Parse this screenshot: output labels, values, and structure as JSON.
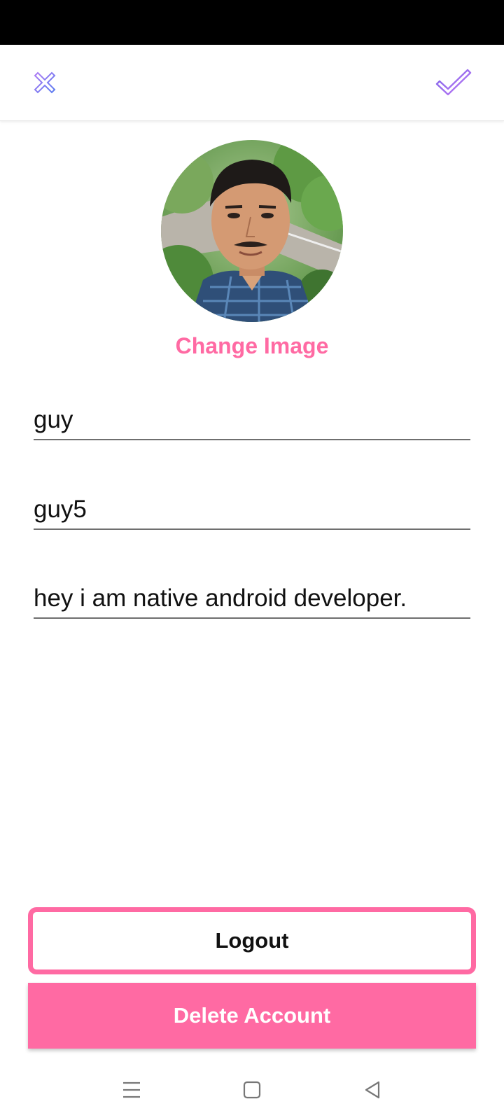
{
  "toolbar": {
    "close_icon": "close-icon",
    "confirm_icon": "check-icon",
    "icon_color": "#8a6cf0"
  },
  "profile": {
    "avatar": "profile-photo",
    "change_image_label": "Change Image",
    "name_value": "guy",
    "username_value": "guy5",
    "bio_value": "hey i am native android developer."
  },
  "actions": {
    "logout_label": "Logout",
    "delete_label": "Delete Account"
  },
  "colors": {
    "accent": "#ff6aa3",
    "status_bar": "#000000"
  },
  "nav": {
    "icons": [
      "menu-icon",
      "home-icon",
      "back-icon"
    ]
  }
}
